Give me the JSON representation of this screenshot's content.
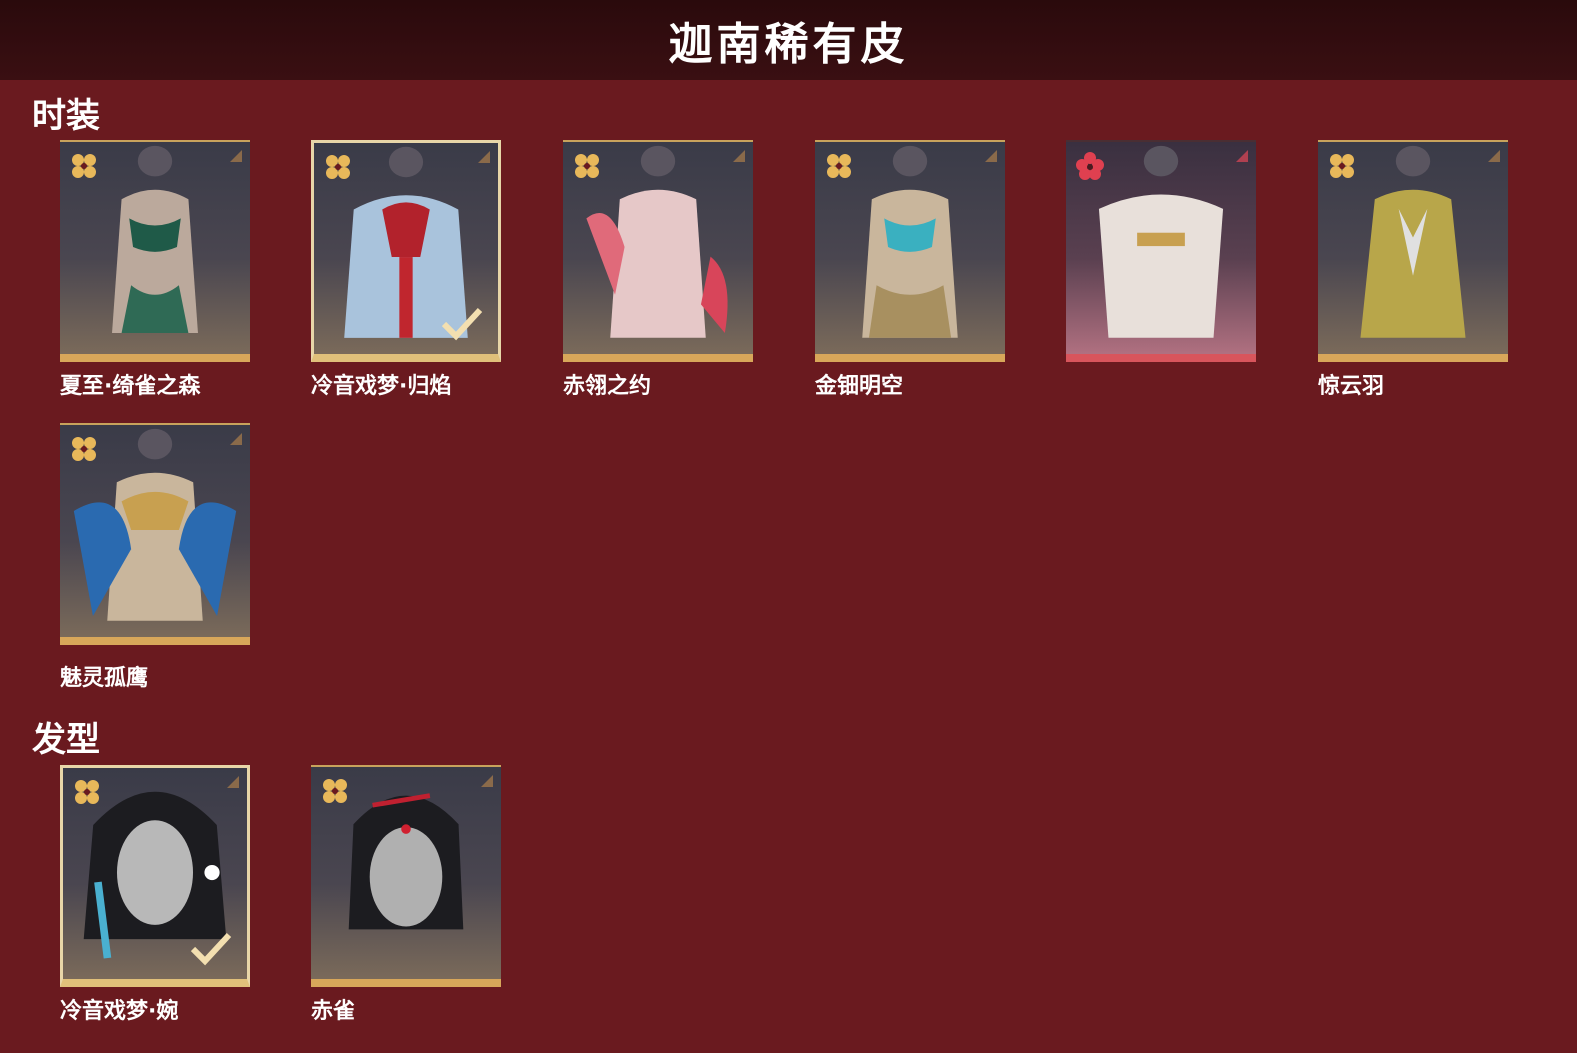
{
  "page": {
    "title": "迦南稀有皮"
  },
  "colors": {
    "background": "#6a1a1f",
    "header": "#2f0c0e",
    "gold_accent": "#d8a75a",
    "red_accent": "#d8555c"
  },
  "sections": [
    {
      "title": "时装",
      "items": [
        {
          "label": "夏至·绮雀之森",
          "rarity_icon": "gold-flower-icon",
          "selected": false
        },
        {
          "label": "冷音戏梦·归焰",
          "rarity_icon": "gold-flower-icon",
          "selected": true
        },
        {
          "label": "赤翎之约",
          "rarity_icon": "gold-flower-icon",
          "selected": false
        },
        {
          "label": "金钿明空",
          "rarity_icon": "gold-flower-icon",
          "selected": false
        },
        {
          "label": "",
          "rarity_icon": "red-flower-icon",
          "selected": false
        },
        {
          "label": "惊云羽",
          "rarity_icon": "gold-flower-icon",
          "selected": false
        },
        {
          "label": "魅灵孤鹰",
          "rarity_icon": "gold-flower-icon",
          "selected": false
        }
      ]
    },
    {
      "title": "发型",
      "items": [
        {
          "label": "冷音戏梦·婉",
          "rarity_icon": "gold-flower-icon",
          "selected": true
        },
        {
          "label": "赤雀",
          "rarity_icon": "gold-flower-icon",
          "selected": false
        }
      ]
    }
  ]
}
